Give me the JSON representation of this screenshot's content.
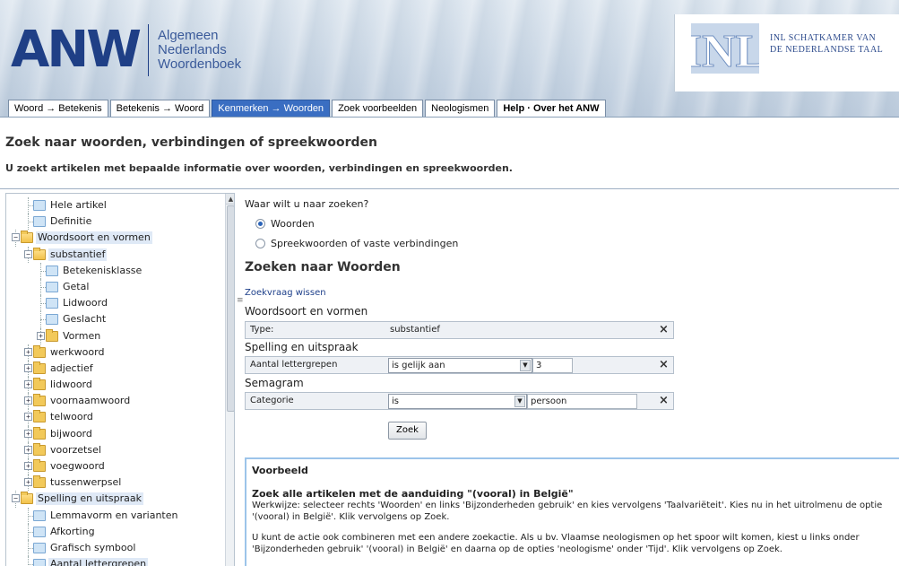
{
  "header": {
    "logo_letters": "ANW",
    "logo_line1": "Algemeen",
    "logo_line2": "Nederlands",
    "logo_line3": "Woordenboek",
    "inl_mark": "INL",
    "inl_line1": "INL SCHATKAMER VAN",
    "inl_line2": "DE NEDERLANDSE TAAL",
    "brand_color": "#1f3f86"
  },
  "tabs": [
    {
      "label": "Woord → Betekenis"
    },
    {
      "label": "Betekenis → Woord"
    },
    {
      "label": "Kenmerken → Woorden",
      "active": true
    },
    {
      "label": "Zoek voorbeelden"
    },
    {
      "label": "Neologismen"
    },
    {
      "label": "Help · Over het ANW"
    }
  ],
  "page": {
    "title": "Zoek naar woorden, verbindingen of spreekwoorden",
    "subtitle": "U zoekt artikelen met bepaalde informatie over woorden, verbindingen en spreekwoorden."
  },
  "tree": {
    "items": [
      {
        "label": "Hele artikel",
        "icon": "book-icon"
      },
      {
        "label": "Definitie",
        "icon": "book-icon"
      },
      {
        "label": "Woordsoort en vormen",
        "icon": "folder-open-icon",
        "expanded": true,
        "selected": true
      },
      {
        "label": "substantief",
        "icon": "folder-open-icon",
        "expanded": true,
        "selected": true
      },
      {
        "label": "Betekenisklasse",
        "icon": "book-icon"
      },
      {
        "label": "Getal",
        "icon": "book-icon"
      },
      {
        "label": "Lidwoord",
        "icon": "book-icon"
      },
      {
        "label": "Geslacht",
        "icon": "book-icon"
      },
      {
        "label": "Vormen",
        "icon": "folder-icon"
      },
      {
        "label": "werkwoord",
        "icon": "folder-icon"
      },
      {
        "label": "adjectief",
        "icon": "folder-icon"
      },
      {
        "label": "lidwoord",
        "icon": "folder-icon"
      },
      {
        "label": "voornaamwoord",
        "icon": "folder-icon"
      },
      {
        "label": "telwoord",
        "icon": "folder-icon"
      },
      {
        "label": "bijwoord",
        "icon": "folder-icon"
      },
      {
        "label": "voorzetsel",
        "icon": "folder-icon"
      },
      {
        "label": "voegwoord",
        "icon": "folder-icon"
      },
      {
        "label": "tussenwerpsel",
        "icon": "folder-icon"
      },
      {
        "label": "Spelling en uitspraak",
        "icon": "folder-open-icon",
        "expanded": true,
        "selected": true
      },
      {
        "label": "Lemmavorm en varianten",
        "icon": "book-icon"
      },
      {
        "label": "Afkorting",
        "icon": "book-icon"
      },
      {
        "label": "Grafisch symbool",
        "icon": "book-icon"
      },
      {
        "label": "Aantal lettergrepen",
        "icon": "book-icon",
        "selected": true
      }
    ]
  },
  "form": {
    "question": "Waar wilt u naar zoeken?",
    "option_words": "Woorden",
    "option_sayings": "Spreekwoorden of vaste verbindingen",
    "section_title": "Zoeken naar Woorden",
    "clear_link": "Zoekvraag wissen",
    "group1": "Woordsoort en vormen",
    "c1_name": "Type:",
    "c1_value": "substantief",
    "group2": "Spelling en uitspraak",
    "c2_name": "Aantal lettergrepen",
    "c2_op": "is gelijk aan",
    "c2_value": "3",
    "group3": "Semagram",
    "c3_name": "Categorie",
    "c3_op": "is",
    "c3_value": "persoon",
    "remove_glyph": "×",
    "submit": "Zoek"
  },
  "example": {
    "title": "Voorbeeld",
    "heading": "Zoek alle artikelen met de aanduiding \"(vooral) in België\"",
    "para1": "Werkwijze: selecteer rechts 'Woorden' en links 'Bijzonderheden gebruik' en kies vervolgens 'Taalvariëteit'. Kies nu in het uitrolmenu de optie '(vooral) in België'. Klik vervolgens op Zoek.",
    "para2": "U kunt de actie ook combineren met een andere zoekactie. Als u bv. Vlaamse neologismen op het spoor wilt komen, kiest u links onder 'Bijzonderheden gebruik' '(vooral) in België' en daarna op de opties 'neologisme' onder 'Tijd'. Klik vervolgens op Zoek."
  }
}
